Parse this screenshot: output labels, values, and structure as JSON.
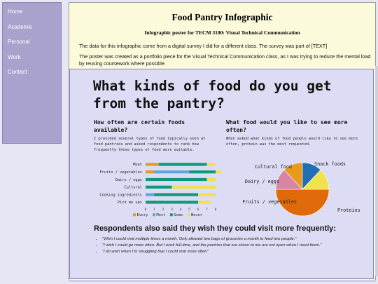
{
  "nav": {
    "items": [
      "Home",
      "Academic",
      "Personal",
      "Work",
      "Contact"
    ]
  },
  "header": {
    "title": "Food Pantry Infographic",
    "subtitle": "Infographic poster for TECM 3100: Visual Technical Communication"
  },
  "intro": {
    "p1": "The data for this infographic come from a digital survey I did for a different class. The survey was part of [TEXT]",
    "p2": "The poster was created as a portfolio piece for the Visual Technical Communication class, as I was trying to reduce the mental load by reusing coursework where possible."
  },
  "poster": {
    "title": "What kinds of food do you get from the pantry?",
    "section1": {
      "heading": "How often are certain foods available?",
      "body": "I provided several types of food typically seen at food pantries and asked respondents to rank how frequently those types of food were avilable."
    },
    "section2": {
      "heading": "What food would you like to see more often?",
      "body": "When asked what kinds of food people would like to see more often, protein was the most requested."
    },
    "quotes_heading": "Respondents also said they wish they could visit more frequently:",
    "quotes": [
      "“Wish I could visit multiple times a month. Only allowed two bags of groceries a month to feed two people.”",
      "“I wish I could go more often. But I work full-time, and the pantries that are closer to me are not open when I need them.”",
      "“I do wish when I’m struggling that I could visit more often”"
    ]
  },
  "colors": {
    "every": "#e89a1c",
    "most": "#5aa8e0",
    "some": "#0e9a78",
    "never": "#f1e14a",
    "pie_protein": "#e06a0a",
    "pie_fruits": "#d685a6",
    "pie_dairy": "#e89a1c",
    "pie_cultural": "#1f6fb2",
    "pie_snack": "#f1e14a"
  },
  "chart_data": [
    {
      "type": "bar",
      "stacked": true,
      "orientation": "horizontal",
      "categories": [
        "Meat",
        "Fruits / vegetables",
        "Dairy / eggs",
        "Cultural",
        "Cooking ingredients",
        "Pick me ups"
      ],
      "series": [
        {
          "name": "Every",
          "values": [
            1.5,
            1.0,
            0,
            0,
            0,
            0
          ]
        },
        {
          "name": "Most",
          "values": [
            0,
            4.0,
            0,
            0,
            1.0,
            0
          ]
        },
        {
          "name": "Some",
          "values": [
            5.5,
            3.0,
            7.0,
            3.0,
            5.0,
            6.0
          ]
        },
        {
          "name": "Never",
          "values": [
            1.0,
            1.0,
            1.0,
            5.0,
            2.0,
            1.5
          ]
        }
      ],
      "xticks": [
        "0",
        "1",
        "2",
        "3",
        "4",
        "5",
        "6",
        "7",
        "8"
      ],
      "xlim": [
        0,
        8
      ],
      "legend": "bottom"
    },
    {
      "type": "pie",
      "labels": [
        "Proteins",
        "Fruits / vegetables",
        "Dairy / eggs",
        "Cultural food",
        "Snack foods"
      ],
      "values": [
        50,
        13,
        12,
        12,
        13
      ]
    }
  ]
}
